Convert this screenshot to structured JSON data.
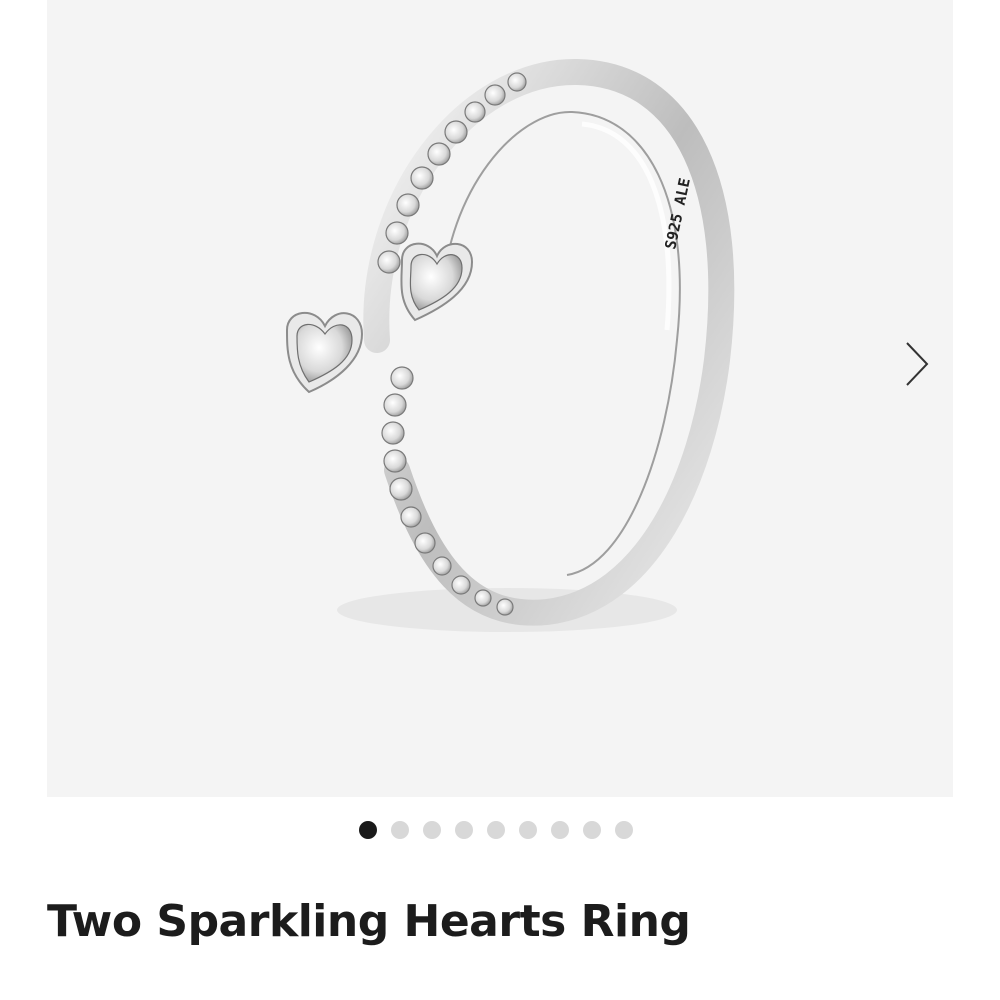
{
  "product": {
    "title": "Two Sparkling Hearts Ring",
    "image": {
      "subject": "ring",
      "engraving": "S925 ALE",
      "background_color": "#f4f4f4"
    }
  },
  "gallery": {
    "next_icon": "chevron-right-icon",
    "dot_count": 9,
    "active_index": 0,
    "dots": [
      {
        "active": true
      },
      {
        "active": false
      },
      {
        "active": false
      },
      {
        "active": false
      },
      {
        "active": false
      },
      {
        "active": false
      },
      {
        "active": false
      },
      {
        "active": false
      },
      {
        "active": false
      }
    ]
  },
  "colors": {
    "title": "#1c1c1c",
    "dot_active": "#1a1a1a",
    "dot_inactive": "#d8d8d8"
  }
}
